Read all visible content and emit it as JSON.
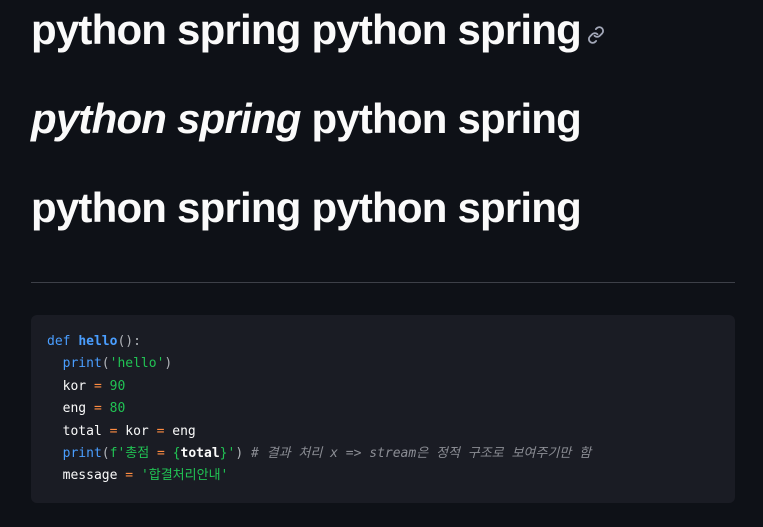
{
  "headings": {
    "h1": {
      "text": "python spring python spring",
      "anchor_icon": "link-icon"
    },
    "h2": {
      "italic_part": "python spring",
      "normal_part": " python spring"
    },
    "h3": {
      "text": "python spring python spring"
    }
  },
  "code": {
    "line1": {
      "kw": "def",
      "name": "hello",
      "punc": "():"
    },
    "line2": {
      "indent": "  ",
      "fn": "print",
      "open": "(",
      "str": "'hello'",
      "close": ")"
    },
    "line3": {
      "indent": "  ",
      "var": "kor",
      "op": "=",
      "num": "90"
    },
    "line4": {
      "indent": "  ",
      "var": "eng",
      "op": "=",
      "num": "80"
    },
    "line5": {
      "indent": "  ",
      "var": "total",
      "op1": "=",
      "var2": "kor",
      "op2": "=",
      "var3": "eng"
    },
    "line6": {
      "indent": "  ",
      "fn": "print",
      "open": "(",
      "fstr1": "f'총점 ",
      "eq": "=",
      "brace_open": " {",
      "inner": "total",
      "brace_close": "}",
      "fstr2": "'",
      "close": ")",
      "comment": "# 결과 처리 x => stream은 정적 구조로 보여주기만 함"
    },
    "line7": {
      "indent": "  ",
      "var": "message",
      "op": "=",
      "str": "'합결처리안내'"
    }
  }
}
